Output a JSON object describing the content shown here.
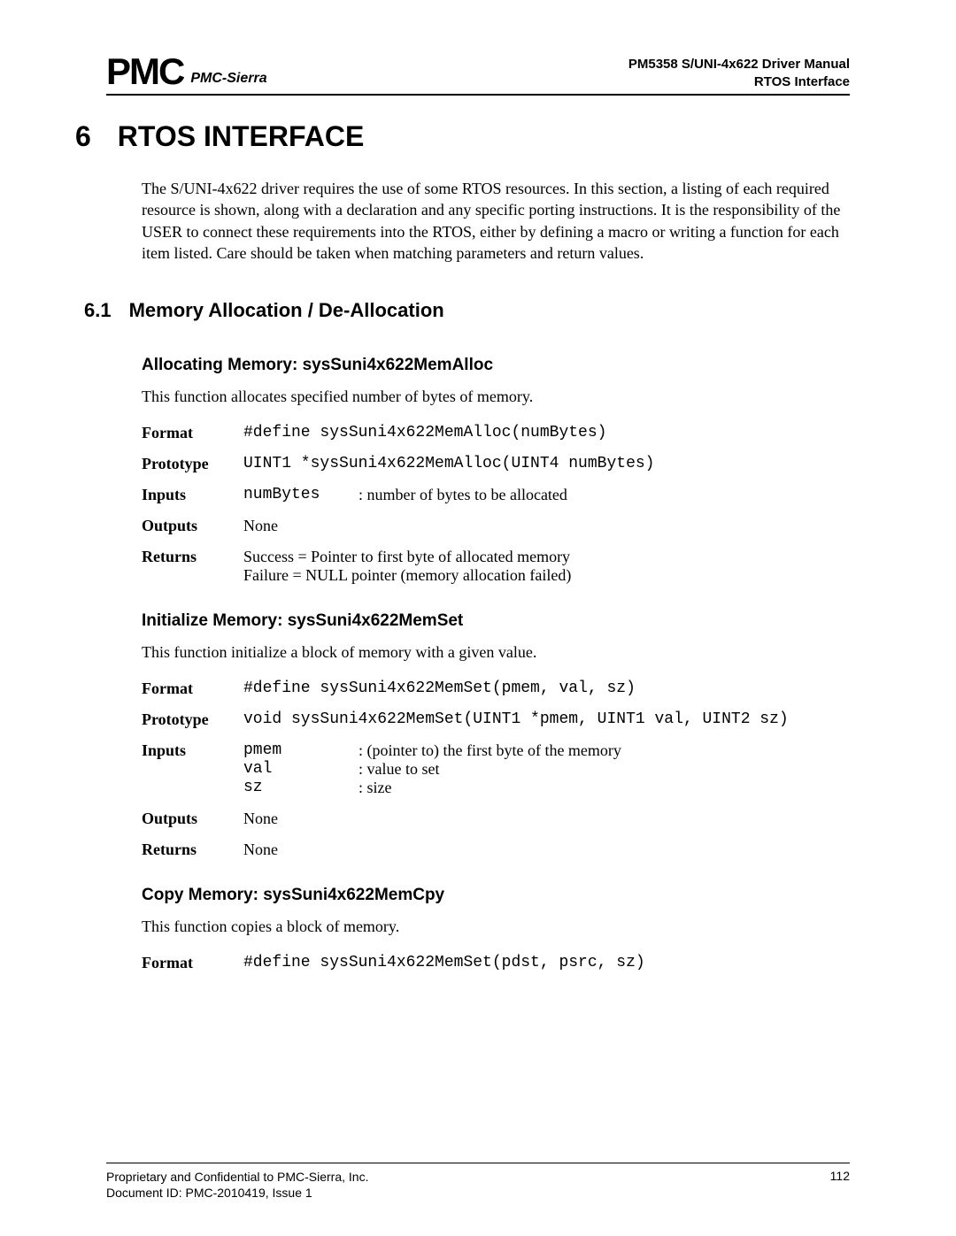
{
  "header": {
    "logo_main": "PMC",
    "logo_sub": "PMC-Sierra",
    "right_line1": "PM5358 S/UNI-4x622 Driver Manual",
    "right_line2": "RTOS Interface"
  },
  "chapter": {
    "number": "6",
    "title": "RTOS INTERFACE"
  },
  "intro": "The S/UNI-4x622 driver requires the use of some RTOS resources. In this section, a listing of each required resource is shown, along with a declaration and any specific porting instructions. It is the responsibility of the USER to connect these requirements into the RTOS, either by defining a macro or writing a function for each item listed. Care should be taken when matching parameters and return values.",
  "section": {
    "number": "6.1",
    "title": "Memory Allocation / De-Allocation"
  },
  "labels": {
    "format": "Format",
    "prototype": "Prototype",
    "inputs": "Inputs",
    "outputs": "Outputs",
    "returns": "Returns",
    "none": "None"
  },
  "func1": {
    "title": "Allocating Memory: sysSuni4x622MemAlloc",
    "desc": "This function allocates specified number of bytes of memory.",
    "format": "#define sysSuni4x622MemAlloc(numBytes)",
    "prototype": "UINT1 *sysSuni4x622MemAlloc(UINT4 numBytes)",
    "inputs": [
      {
        "param": "numBytes",
        "desc": ": number of bytes to be allocated"
      }
    ],
    "outputs": "None",
    "returns_line1": "Success = Pointer to first byte of allocated memory",
    "returns_line2": "Failure = NULL pointer (memory allocation failed)"
  },
  "func2": {
    "title": "Initialize Memory: sysSuni4x622MemSet",
    "desc": "This function initialize a block of memory with a given value.",
    "format": "#define sysSuni4x622MemSet(pmem, val, sz)",
    "prototype": "void sysSuni4x622MemSet(UINT1 *pmem, UINT1 val, UINT2 sz)",
    "inputs": [
      {
        "param": "pmem",
        "desc": ": (pointer to) the first byte of the memory"
      },
      {
        "param": "val",
        "desc": ": value to set"
      },
      {
        "param": "sz",
        "desc": ": size"
      }
    ],
    "outputs": "None",
    "returns": "None"
  },
  "func3": {
    "title": "Copy Memory: sysSuni4x622MemCpy",
    "desc": "This function copies a block of memory.",
    "format": "#define sysSuni4x622MemSet(pdst, psrc, sz)"
  },
  "footer": {
    "left_line1": "Proprietary and Confidential to PMC-Sierra, Inc.",
    "left_line2": "Document ID: PMC-2010419, Issue 1",
    "page": "112"
  }
}
